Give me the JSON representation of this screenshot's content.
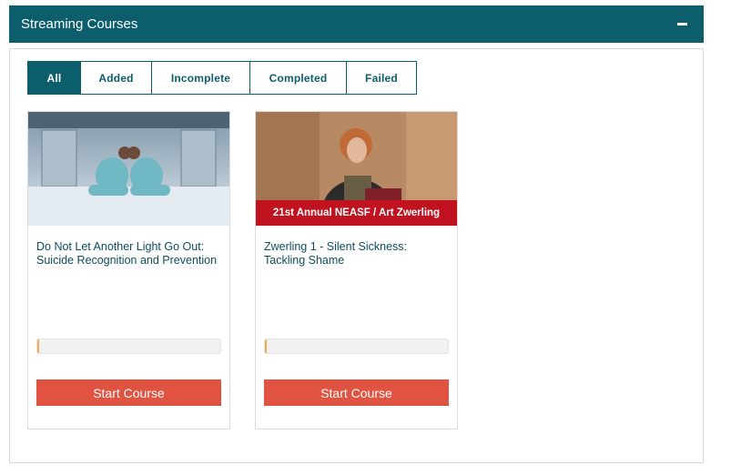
{
  "panel": {
    "title": "Streaming Courses",
    "collapse_icon": "minus-icon"
  },
  "tabs": [
    {
      "label": "All",
      "active": true
    },
    {
      "label": "Added",
      "active": false
    },
    {
      "label": "Incomplete",
      "active": false
    },
    {
      "label": "Completed",
      "active": false
    },
    {
      "label": "Failed",
      "active": false
    }
  ],
  "courses": [
    {
      "title": "Do Not Let Another Light Go Out: Suicide Recognition and Prevention",
      "thumbnail_banner": "",
      "progress_fraction": 0.0,
      "button_label": "Start Course"
    },
    {
      "title": "Zwerling 1 - Silent Sickness: Tackling Shame",
      "thumbnail_banner": "21st Annual NEASF / Art Zwerling",
      "progress_fraction": 0.0,
      "button_label": "Start Course"
    }
  ],
  "colors": {
    "brand": "#0d5e6d",
    "button": "#e05340",
    "banner": "#c1121f",
    "progress": "#f0ad4e"
  }
}
